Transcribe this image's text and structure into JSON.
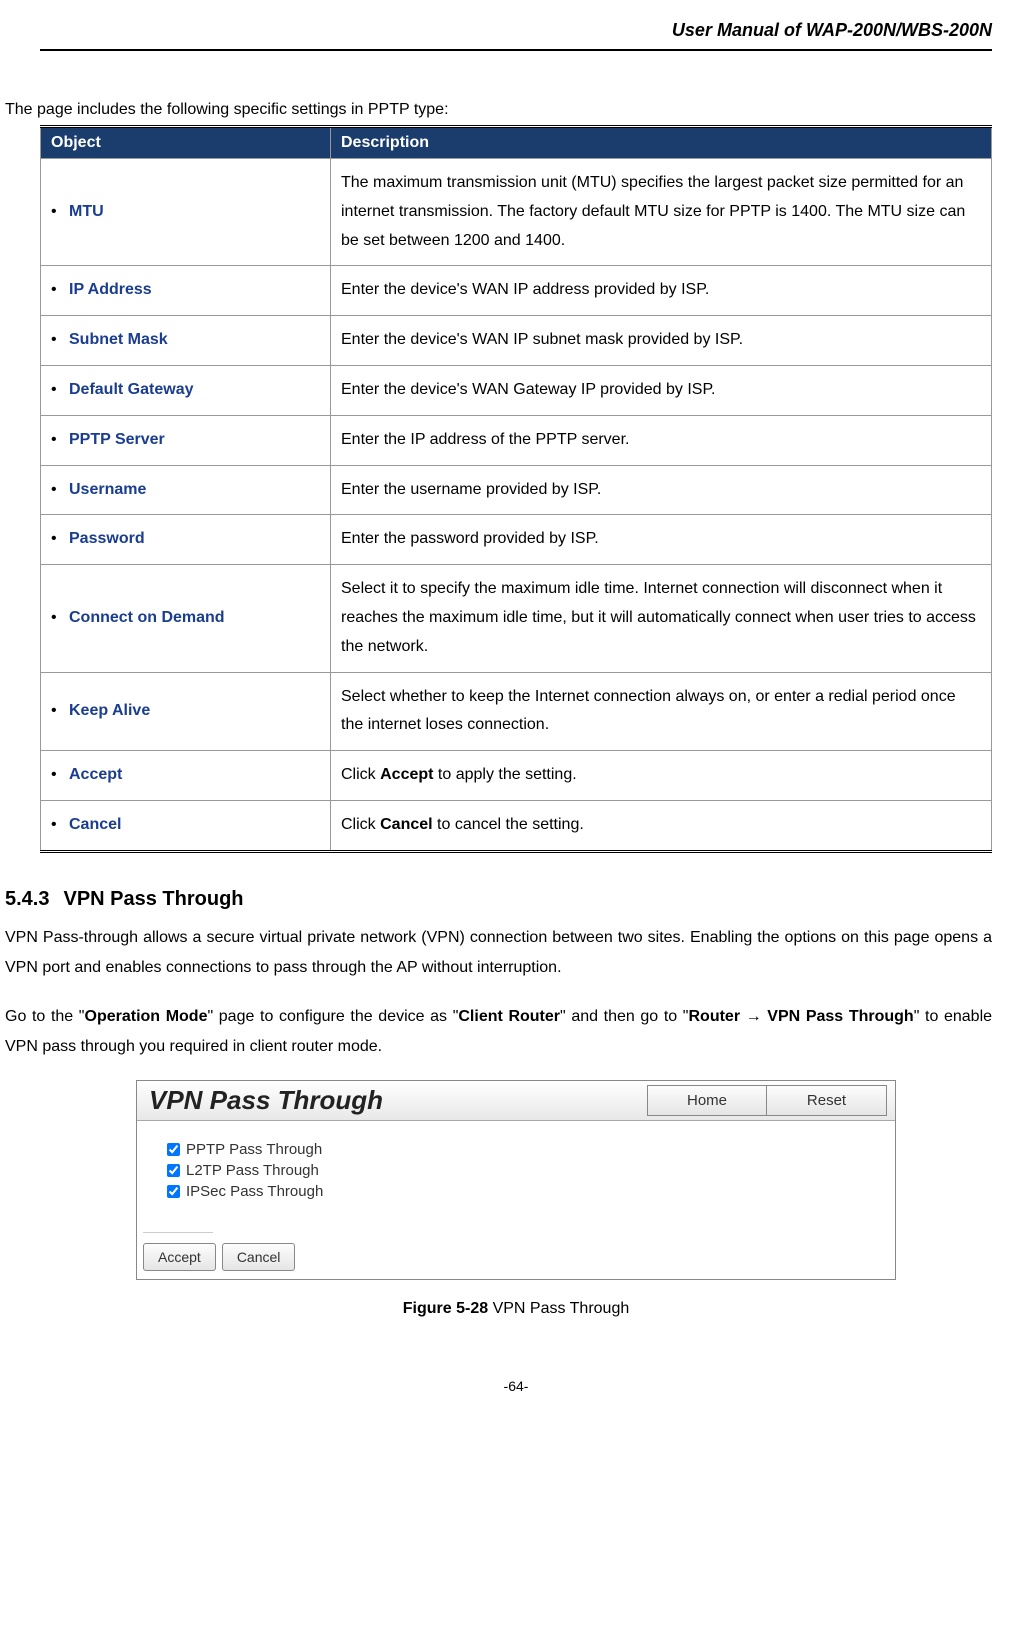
{
  "header": {
    "title": "User Manual of WAP-200N/WBS-200N"
  },
  "intro": "The page includes the following specific settings in PPTP type:",
  "tableHeaders": {
    "object": "Object",
    "description": "Description"
  },
  "rows": [
    {
      "object": "MTU",
      "description": "The maximum transmission unit (MTU) specifies the largest packet size permitted for an internet transmission. The factory default MTU size for PPTP is 1400. The MTU size can be set between 1200 and 1400."
    },
    {
      "object": "IP Address",
      "description": "Enter the device's WAN IP address provided by ISP."
    },
    {
      "object": "Subnet Mask",
      "description": "Enter the device's WAN IP subnet mask provided by ISP."
    },
    {
      "object": "Default Gateway",
      "description": "Enter the device's WAN Gateway IP provided by ISP."
    },
    {
      "object": "PPTP Server",
      "description": "Enter the IP address of the PPTP server."
    },
    {
      "object": "Username",
      "description": "Enter the username provided by ISP."
    },
    {
      "object": "Password",
      "description": "Enter the password provided by ISP."
    },
    {
      "object": "Connect on Demand",
      "description": "Select it to specify the maximum idle time. Internet connection will disconnect when it reaches the maximum idle time, but it will automatically connect when user tries to access the network."
    },
    {
      "object": "Keep Alive",
      "description": "Select whether to keep the Internet connection always on, or enter a redial period once the internet loses connection."
    },
    {
      "object": "Accept",
      "descPrefix": "Click ",
      "descBold": "Accept",
      "descSuffix": " to apply the setting."
    },
    {
      "object": "Cancel",
      "descPrefix": "Click ",
      "descBold": "Cancel",
      "descSuffix": " to cancel the setting."
    }
  ],
  "section": {
    "number": "5.4.3",
    "title": "VPN Pass Through",
    "para1": "VPN Pass-through allows a secure virtual private network (VPN) connection between two sites. Enabling the options on this page opens a VPN port and enables connections to pass through the AP without interruption.",
    "para2": {
      "t1": "Go to the \"",
      "b1": "Operation Mode",
      "t2": "\" page to configure the device as \"",
      "b2": "Client Router",
      "t3": "\" and then go to \"",
      "b3": "Router → VPN Pass Through",
      "t4": "\" to enable VPN pass through you required in client router mode."
    }
  },
  "figure": {
    "title": "VPN Pass Through",
    "homeBtn": "Home",
    "resetBtn": "Reset",
    "options": [
      {
        "label": "PPTP Pass Through",
        "checked": true
      },
      {
        "label": "L2TP Pass Through",
        "checked": true
      },
      {
        "label": "IPSec Pass Through",
        "checked": true
      }
    ],
    "acceptBtn": "Accept",
    "cancelBtn": "Cancel",
    "captionBold": "Figure 5-28",
    "captionText": " VPN Pass Through"
  },
  "pageNumber": "-64-"
}
